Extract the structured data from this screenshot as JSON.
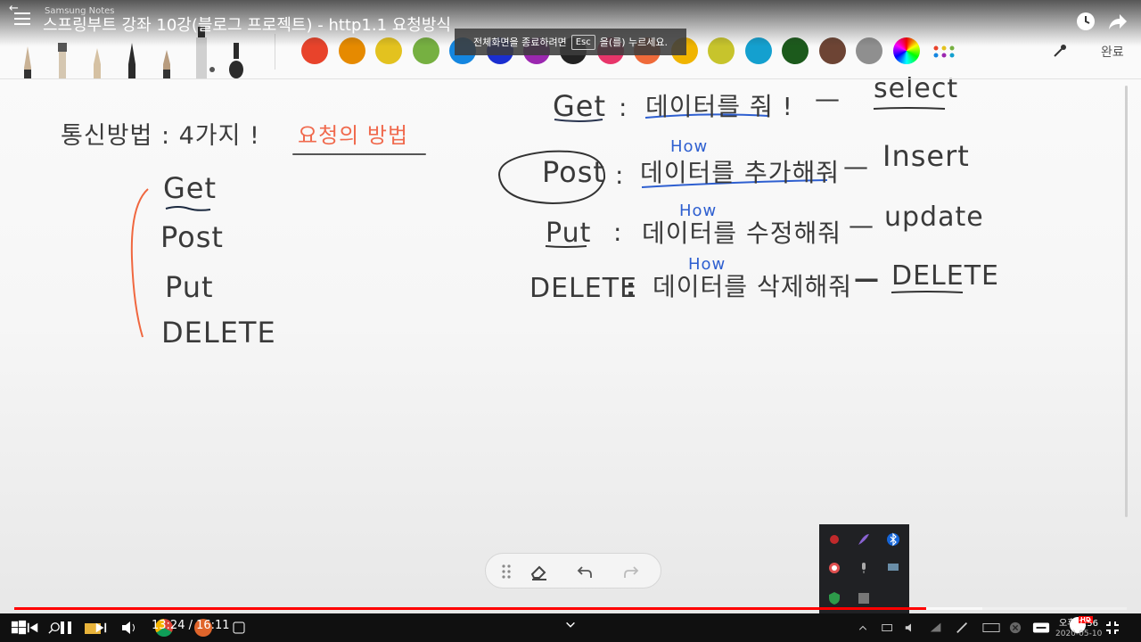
{
  "app": {
    "name": "Samsung Notes",
    "back_glyph": "←"
  },
  "video": {
    "title": "스프링부트 강좌 10강(블로그 프로젝트) - http1.1 요청방식",
    "current_time": "13:24 / 16:11",
    "progress": 0.82,
    "buffered": 0.87
  },
  "fullscreen_tip": {
    "before": "전체화면을 종료하려면",
    "key": "Esc",
    "after": "을(를) 누르세요."
  },
  "toolbar": {
    "done_label": "완료",
    "colors": [
      "#e8432b",
      "#e68a00",
      "#e3c21f",
      "#76b041",
      "#1486e0",
      "#1a2ed0",
      "#9b27b0",
      "#222222",
      "#e8356a",
      "#ef6a3a",
      "#f0b400",
      "#c7c42c",
      "#14a0cf",
      "#1c5a1c",
      "#6d4434",
      "#8f8f8f"
    ],
    "pens": [
      "brush-pen",
      "flat-brush",
      "pencil",
      "fountain-pen",
      "marker",
      "highlighter",
      "calligraphy-pen"
    ]
  },
  "note": {
    "left_heading": "통신방법 : 4가지 !",
    "left_subheading": "요청의 방법",
    "methods": [
      "Get",
      "Post",
      "Put",
      "DELETE"
    ],
    "rows": [
      {
        "method": "Get",
        "desc": "데이터를 줘 !",
        "sql": "select",
        "how": ""
      },
      {
        "method": "Post",
        "desc": "데이터를 추가해줘",
        "sql": "Insert",
        "how": "How"
      },
      {
        "method": "Put",
        "desc": "데이터를 수정해줘",
        "sql": "update",
        "how": "How"
      },
      {
        "method": "DELETE",
        "desc": "데이터를 삭제해줘",
        "sql": "DELETE",
        "how": "How"
      }
    ],
    "row_separators": [
      ":",
      "—"
    ]
  },
  "taskbar": {
    "clock_time": "오후 1:56",
    "clock_date": "2020-05-10",
    "hd_badge": "HD"
  }
}
